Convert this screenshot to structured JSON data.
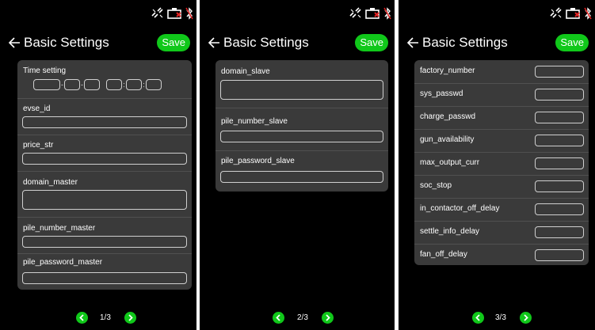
{
  "screens": [
    {
      "title": "Basic Settings",
      "save_label": "Save",
      "time_label": "Time setting",
      "fields": [
        {
          "label": "evse_id"
        },
        {
          "label": "price_str"
        },
        {
          "label": "domain_master"
        },
        {
          "label": "pile_number_master"
        },
        {
          "label": "pile_password_master"
        }
      ],
      "page": "1/3"
    },
    {
      "title": "Basic Settings",
      "save_label": "Save",
      "fields": [
        {
          "label": "domain_slave"
        },
        {
          "label": "pile_number_slave"
        },
        {
          "label": "pile_password_slave"
        }
      ],
      "page": "2/3"
    },
    {
      "title": "Basic Settings",
      "save_label": "Save",
      "fields": [
        {
          "label": "factory_number"
        },
        {
          "label": "sys_passwd"
        },
        {
          "label": "charge_passwd"
        },
        {
          "label": "gun_availability"
        },
        {
          "label": "max_output_curr"
        },
        {
          "label": "soc_stop"
        },
        {
          "label": "in_contactor_off_delay"
        },
        {
          "label": "settle_info_delay"
        },
        {
          "label": "fan_off_delay"
        }
      ],
      "page": "3/3"
    }
  ],
  "status_icons": [
    "link-broken-icon",
    "battery-warning-icon",
    "bluetooth-off-icon"
  ],
  "colors": {
    "accent": "#10c81a",
    "card": "#3a3a3a",
    "background": "#000000",
    "alert": "#e02020"
  }
}
